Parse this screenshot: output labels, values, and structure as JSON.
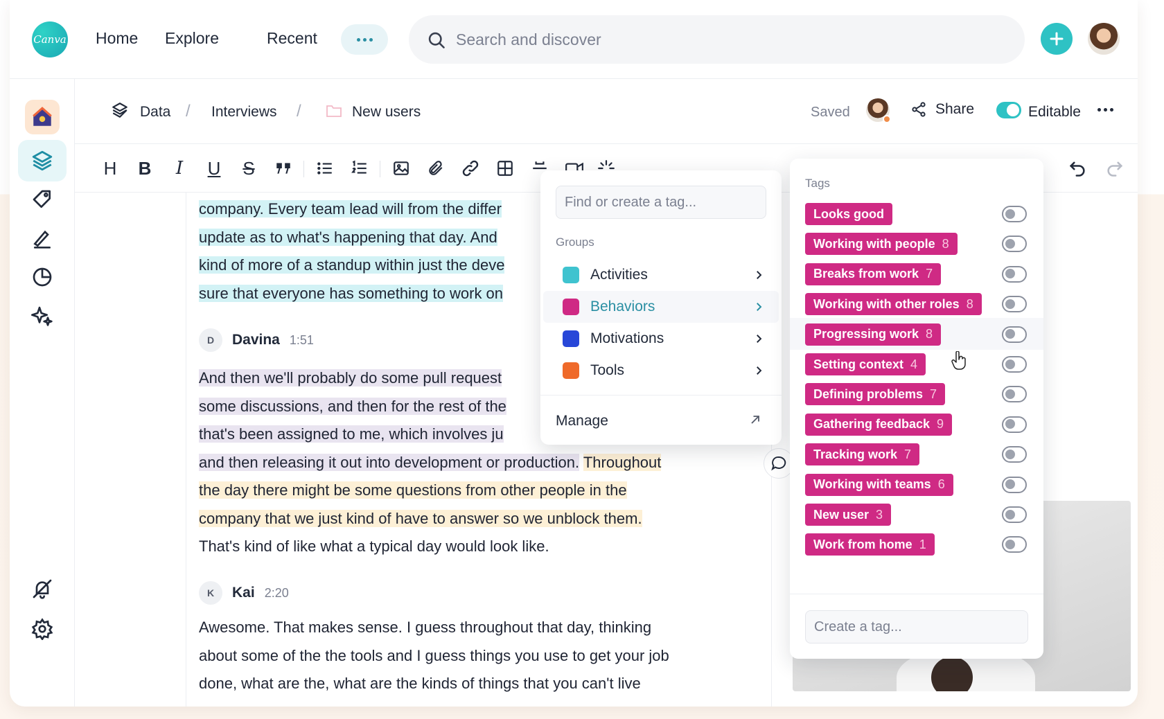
{
  "brand": {
    "logo_text": "Canva",
    "accent": "#2ec2c4",
    "tag_color": "#cf2a84"
  },
  "nav": {
    "home": "Home",
    "explore": "Explore",
    "recent": "Recent"
  },
  "search": {
    "placeholder": "Search and discover"
  },
  "breadcrumb": {
    "data": "Data",
    "interviews": "Interviews",
    "new_users": "New users",
    "separator": "/"
  },
  "doc_status": {
    "saved": "Saved",
    "share": "Share",
    "editable": "Editable"
  },
  "toolbar": {
    "heading": "H",
    "bold": "B",
    "italic": "I",
    "underline": "U",
    "strike": "S"
  },
  "transcript": {
    "block1": {
      "lines": [
        "company. Every team lead will from the differ",
        "update as to what's happening that day. And",
        "kind of more of a standup within just the deve",
        "sure that everyone has something to work on"
      ]
    },
    "davina": {
      "initial": "D",
      "name": "Davina",
      "time": "1:51",
      "lines": [
        "And then we'll probably do some pull request",
        "some discussions, and then for the rest of the",
        "that's been assigned to me, which involves ju",
        "and then releasing it out into development or production.",
        "Throughout",
        "the day there might be some questions from other people in the",
        "company that we just kind of have to answer so we unblock them.",
        "That's kind of like what a typical day would look like."
      ]
    },
    "kai": {
      "initial": "K",
      "name": "Kai",
      "time": "2:20",
      "lines": [
        "Awesome. That makes sense. I guess throughout that day, thinking",
        "about some of the the tools and I guess things you use to get your job",
        "done, what are the, what are the kinds of things that you can't live"
      ]
    }
  },
  "tag_menu": {
    "placeholder": "Find or create a tag...",
    "groups_label": "Groups",
    "groups": [
      {
        "label": "Activities",
        "color": "#3fc3cf"
      },
      {
        "label": "Behaviors",
        "color": "#cf2a84"
      },
      {
        "label": "Motivations",
        "color": "#2847d8"
      },
      {
        "label": "Tools",
        "color": "#ef6a2a"
      }
    ],
    "manage": "Manage"
  },
  "tags_panel": {
    "title": "Tags",
    "tags": [
      {
        "label": "Looks good",
        "count": ""
      },
      {
        "label": "Working with people",
        "count": "8"
      },
      {
        "label": "Breaks from work",
        "count": "7"
      },
      {
        "label": "Working with other roles",
        "count": "8"
      },
      {
        "label": "Progressing work",
        "count": "8"
      },
      {
        "label": "Setting context",
        "count": "4"
      },
      {
        "label": "Defining problems",
        "count": "7"
      },
      {
        "label": "Gathering feedback",
        "count": "9"
      },
      {
        "label": "Tracking work",
        "count": "7"
      },
      {
        "label": "Working with teams",
        "count": "6"
      },
      {
        "label": "New user",
        "count": "3"
      },
      {
        "label": "Work from home",
        "count": "1"
      }
    ],
    "create_placeholder": "Create a tag..."
  }
}
